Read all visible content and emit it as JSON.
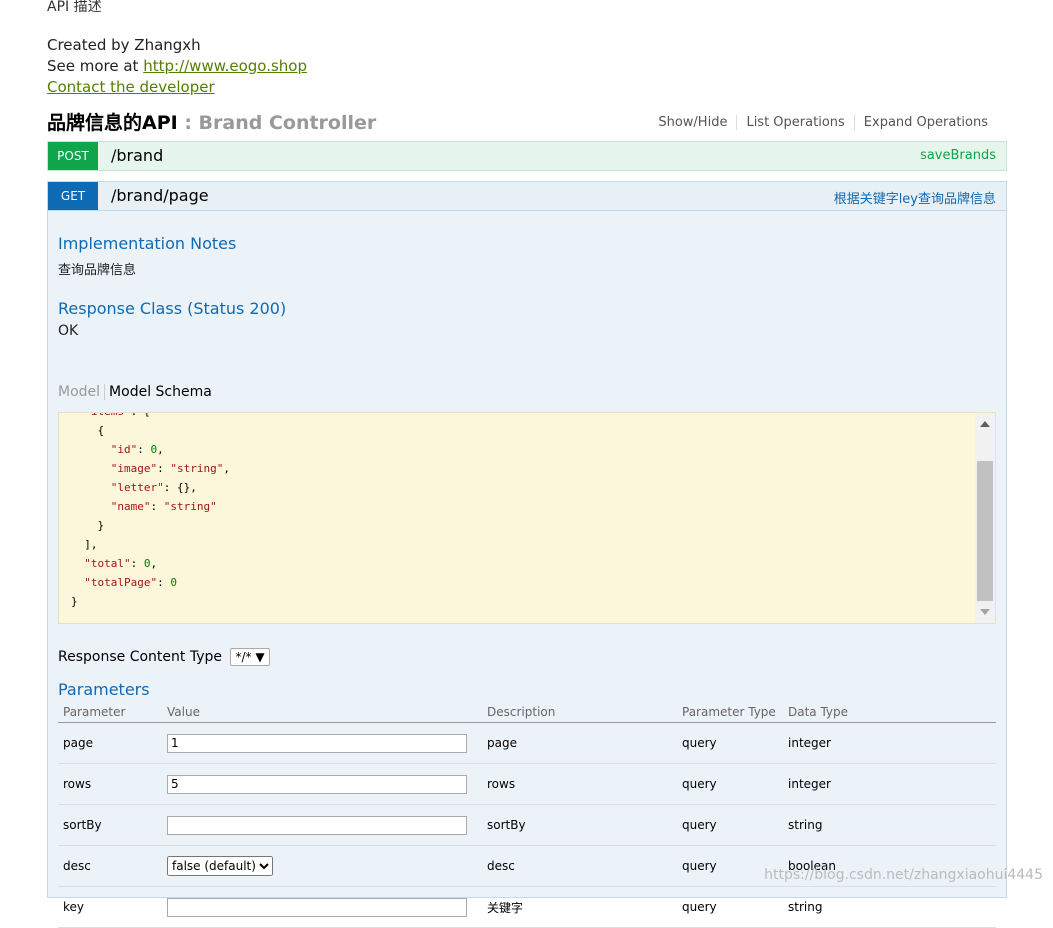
{
  "info": {
    "description": "API 描述",
    "created_by": "Created by Zhangxh",
    "see_more_prefix": "See more at ",
    "see_more_link": "http://www.eogo.shop",
    "contact": "Contact the developer"
  },
  "resource": {
    "title": "品牌信息的API",
    "separator": " : ",
    "controller": "Brand Controller",
    "actions": [
      "Show/Hide",
      "List Operations",
      "Expand Operations"
    ]
  },
  "operations": [
    {
      "method": "POST",
      "path": "/brand",
      "summary": "saveBrands",
      "color": "#10a54a"
    },
    {
      "method": "GET",
      "path": "/brand/page",
      "summary": "根据关键字ley查询品牌信息",
      "color": "#0f6ab4"
    }
  ],
  "get_detail": {
    "impl_notes_title": "Implementation Notes",
    "impl_notes": "查询品牌信息",
    "response_class_title": "Response Class (Status 200)",
    "response_class": "OK",
    "model_tab": "Model",
    "schema_tab": "Model Schema",
    "response_content_type_label": "Response Content Type",
    "response_content_type_value": "*/*",
    "parameters_title": "Parameters",
    "columns": [
      "Parameter",
      "Value",
      "Description",
      "Parameter Type",
      "Data Type"
    ],
    "params": [
      {
        "name": "page",
        "value": "1",
        "description": "page",
        "param_type": "query",
        "data_type": "integer",
        "input": "text"
      },
      {
        "name": "rows",
        "value": "5",
        "description": "rows",
        "param_type": "query",
        "data_type": "integer",
        "input": "text"
      },
      {
        "name": "sortBy",
        "value": "",
        "description": "sortBy",
        "param_type": "query",
        "data_type": "string",
        "input": "text"
      },
      {
        "name": "desc",
        "value": "false (default)",
        "description": "desc",
        "param_type": "query",
        "data_type": "boolean",
        "input": "select"
      },
      {
        "name": "key",
        "value": "",
        "description": "关键字",
        "param_type": "query",
        "data_type": "string",
        "input": "text"
      }
    ]
  },
  "watermark": "https://blog.csdn.net/zhangxiaohui4445"
}
